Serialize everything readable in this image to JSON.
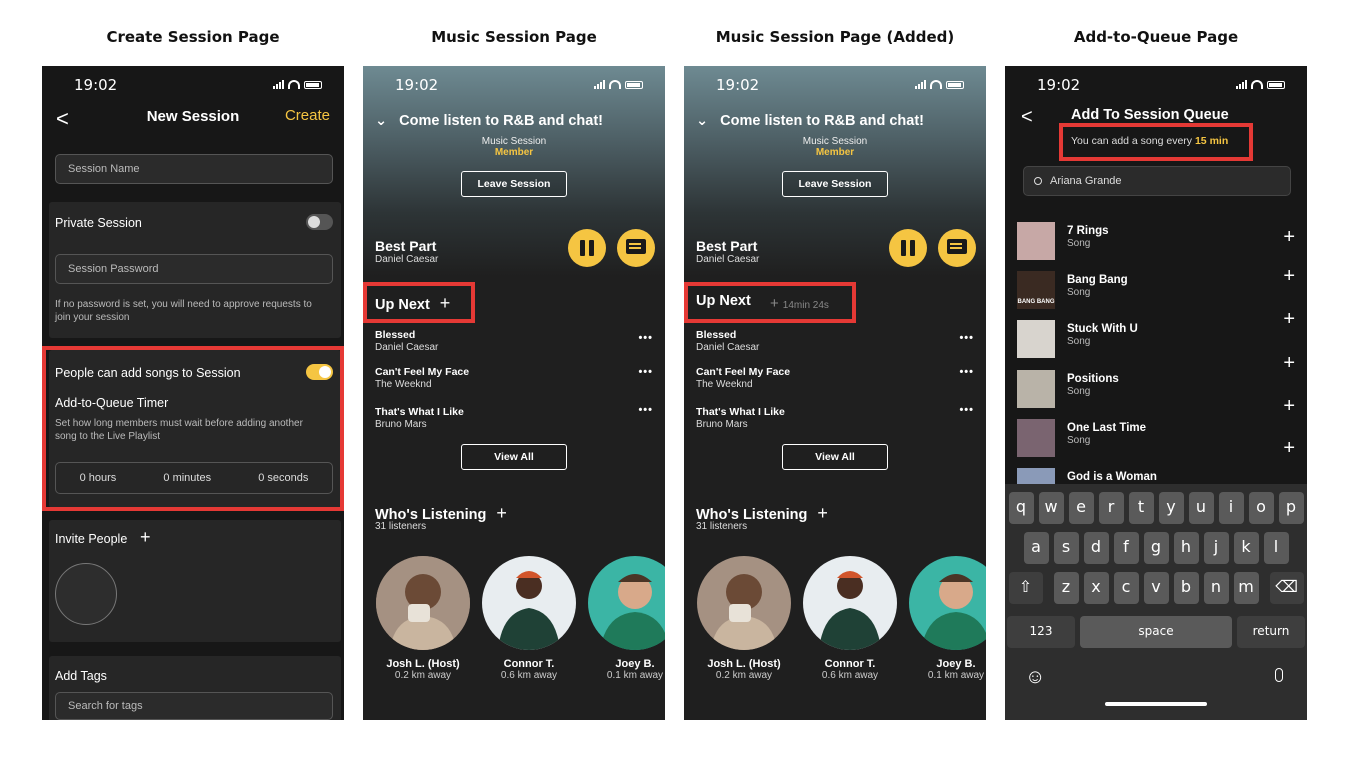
{
  "column_titles": [
    "Create Session Page",
    "Music Session Page",
    "Music Session Page (Added)",
    "Add-to-Queue Page"
  ],
  "status_time": "19:02",
  "create_session": {
    "back": "<",
    "title": "New Session",
    "create_label": "Create",
    "session_name_placeholder": "Session Name",
    "private_label": "Private Session",
    "password_placeholder": "Session Password",
    "password_help": "If no password is set, you will need to approve requests to join your session",
    "add_songs_label": "People can add songs to Session",
    "timer_label": "Add-to-Queue Timer",
    "timer_help": "Set how long members must wait before adding another song to the Live Playlist",
    "timer_hours": "0 hours",
    "timer_minutes": "0 minutes",
    "timer_seconds": "0 seconds",
    "invite_label": "Invite People",
    "add_tags_label": "Add Tags",
    "tags_placeholder": "Search for tags"
  },
  "music_session": {
    "title": "Come listen to R&B and chat!",
    "subtitle": "Music Session",
    "role": "Member",
    "leave_label": "Leave Session",
    "now_playing_title": "Best Part",
    "now_playing_artist": "Daniel Caesar",
    "up_next_label": "Up Next",
    "queue_timer": "14min 24s",
    "queue": [
      {
        "title": "Blessed",
        "artist": "Daniel Caesar"
      },
      {
        "title": "Can't Feel My Face",
        "artist": "The Weeknd"
      },
      {
        "title": "That's What I Like",
        "artist": "Bruno Mars"
      }
    ],
    "more": "•••",
    "view_all_label": "View All",
    "listening_label": "Who's Listening",
    "listener_count": "31 listeners",
    "listeners": [
      {
        "name": "Josh L. (Host)",
        "distance": "0.2 km away"
      },
      {
        "name": "Connor T.",
        "distance": "0.6 km away"
      },
      {
        "name": "Joey B.",
        "distance": "0.1 km away"
      }
    ]
  },
  "add_queue": {
    "title": "Add To Session Queue",
    "note_prefix": "You can add a song every ",
    "note_value": "15 min",
    "search_value": "Ariana Grande",
    "results": [
      {
        "title": "7 Rings",
        "type": "Song"
      },
      {
        "title": "Bang Bang",
        "type": "Song",
        "art_text": "BANG BANG"
      },
      {
        "title": "Stuck With U",
        "type": "Song"
      },
      {
        "title": "Positions",
        "type": "Song"
      },
      {
        "title": "One Last Time",
        "type": "Song"
      },
      {
        "title": "God is a Woman",
        "type": ""
      }
    ],
    "keyboard": {
      "row1": [
        "q",
        "w",
        "e",
        "r",
        "t",
        "y",
        "u",
        "i",
        "o",
        "p"
      ],
      "row2": [
        "a",
        "s",
        "d",
        "f",
        "g",
        "h",
        "j",
        "k",
        "l"
      ],
      "row3": [
        "z",
        "x",
        "c",
        "v",
        "b",
        "n",
        "m"
      ],
      "numbers": "123",
      "space": "space",
      "return": "return"
    }
  },
  "colors": {
    "accent": "#f5c542",
    "highlight": "#e53935",
    "background": "#1f1f1f"
  }
}
